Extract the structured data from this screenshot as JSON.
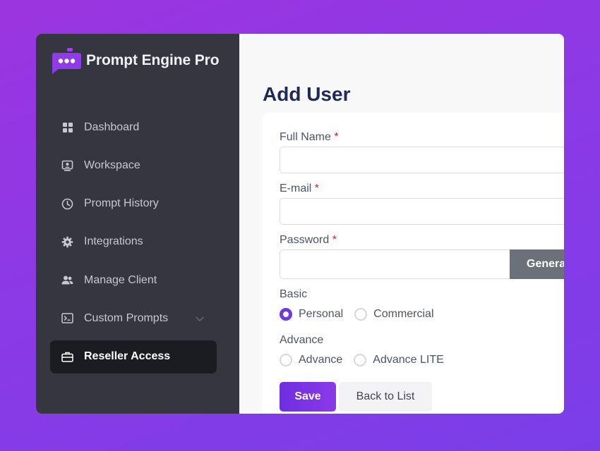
{
  "app": {
    "title": "Prompt Engine Pro"
  },
  "sidebar": {
    "items": [
      {
        "label": "Dashboard",
        "icon": "grid-icon"
      },
      {
        "label": "Workspace",
        "icon": "workspace-icon"
      },
      {
        "label": "Prompt History",
        "icon": "clock-icon"
      },
      {
        "label": "Integrations",
        "icon": "gear-icon"
      },
      {
        "label": "Manage Client",
        "icon": "users-icon"
      },
      {
        "label": "Custom Prompts",
        "icon": "terminal-icon"
      },
      {
        "label": "Reseller Access",
        "icon": "briefcase-icon",
        "active": true
      }
    ]
  },
  "page": {
    "title": "Add User"
  },
  "form": {
    "full_name_label": "Full Name",
    "email_label": "E-mail",
    "password_label": "Password",
    "required_marker": "*",
    "full_name_value": "",
    "email_value": "",
    "password_value": "",
    "generate_button": "Generate",
    "basic_label": "Basic",
    "basic_options": [
      "Personal",
      "Commercial"
    ],
    "basic_selected": "Personal",
    "advance_label": "Advance",
    "advance_options": [
      "Advance",
      "Advance LITE"
    ],
    "save_button": "Save",
    "back_button": "Back to List"
  },
  "colors": {
    "accent": "#6d3ae0",
    "sidebar_bg": "#353640",
    "required": "#c0273a"
  }
}
